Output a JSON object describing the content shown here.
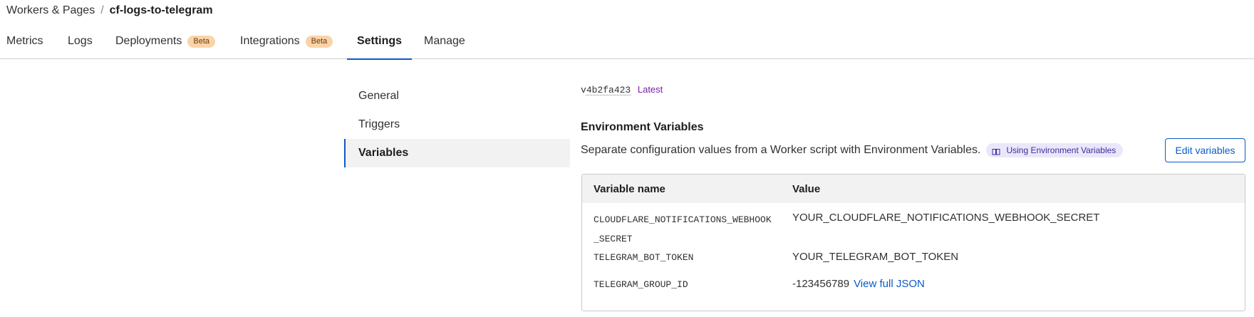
{
  "breadcrumb": {
    "parent": "Workers & Pages",
    "separator": "/",
    "current": "cf-logs-to-telegram"
  },
  "tabs": [
    {
      "label": "Metrics"
    },
    {
      "label": "Logs"
    },
    {
      "label": "Deployments",
      "badge": "Beta"
    },
    {
      "label": "Integrations",
      "badge": "Beta"
    },
    {
      "label": "Settings",
      "active": true
    },
    {
      "label": "Manage"
    }
  ],
  "sidenav": {
    "items": [
      {
        "label": "General"
      },
      {
        "label": "Triggers"
      },
      {
        "label": "Variables",
        "active": true
      }
    ]
  },
  "version": {
    "prefix": "v",
    "hash": "4b2fa423",
    "tag": "Latest"
  },
  "env": {
    "title": "Environment Variables",
    "description": "Separate configuration values from a Worker script with Environment Variables.",
    "doc_link": "Using Environment Variables",
    "edit_button": "Edit variables",
    "table": {
      "headers": [
        "Variable name",
        "Value"
      ],
      "rows": [
        {
          "name": "CLOUDFLARE_NOTIFICATIONS_WEBHOOK_SECRET",
          "value": "YOUR_CLOUDFLARE_NOTIFICATIONS_WEBHOOK_SECRET"
        },
        {
          "name": "TELEGRAM_BOT_TOKEN",
          "value": "YOUR_TELEGRAM_BOT_TOKEN"
        },
        {
          "name": "TELEGRAM_GROUP_ID",
          "value": "-123456789",
          "link": "View full JSON"
        }
      ]
    }
  },
  "colors": {
    "accent": "#0a5bc7",
    "badge_bg": "#fbd3a8",
    "latest": "#7a1fa2",
    "pill_bg": "#ebe7fa"
  }
}
